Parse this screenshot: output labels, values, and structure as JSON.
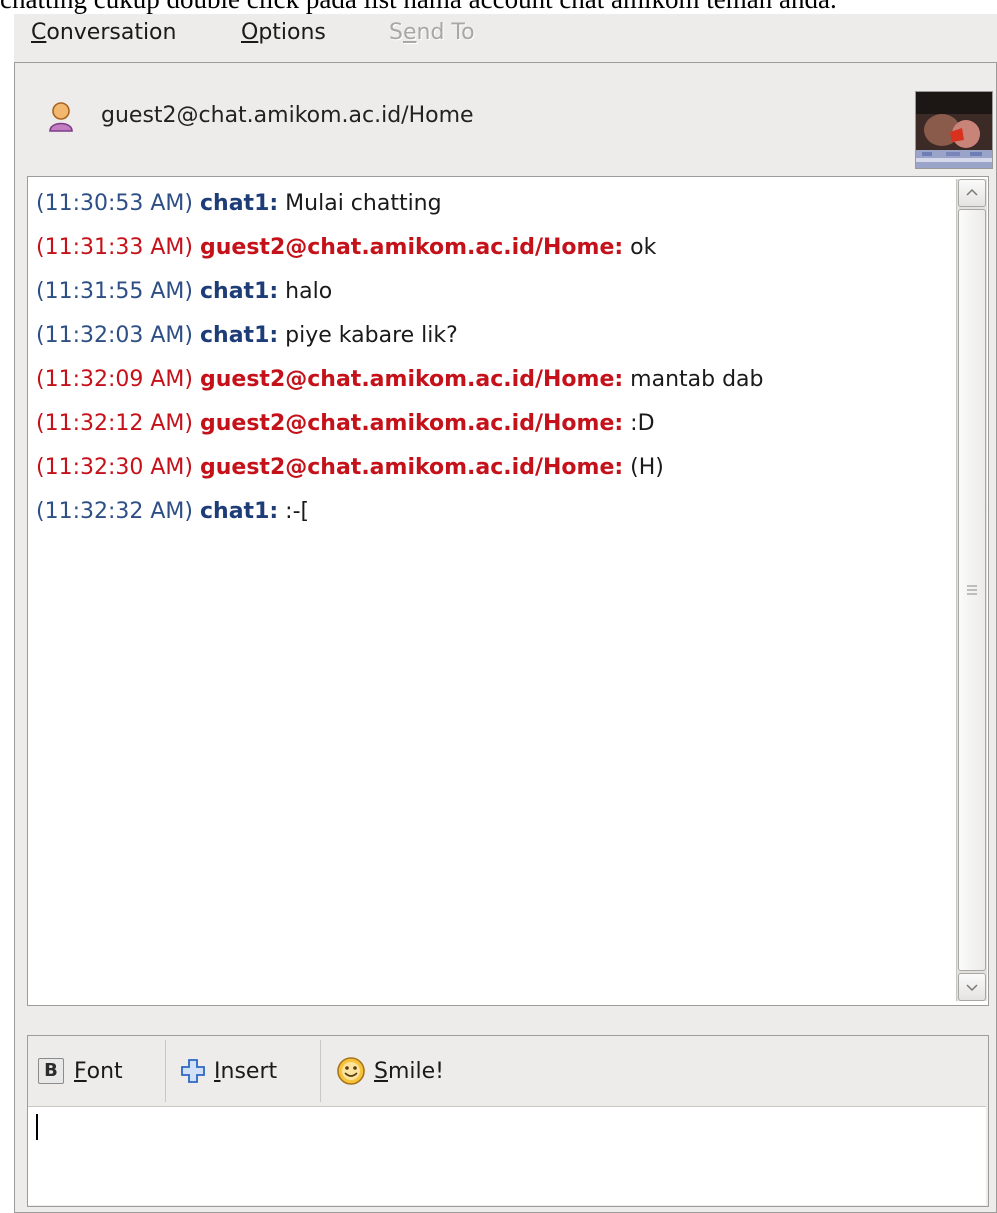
{
  "caption": "chatting cukup double click pada list nama account chat amikom teman anda.",
  "menubar": {
    "conversation": {
      "prefix": "",
      "accel": "C",
      "rest": "onversation"
    },
    "options": {
      "prefix": "",
      "accel": "O",
      "rest": "ptions"
    },
    "send_to": {
      "prefix": "S",
      "accel": "e",
      "rest": "nd To"
    }
  },
  "header": {
    "buddy_name": "guest2@chat.amikom.ac.id/Home",
    "buddy_icon": "person-icon",
    "avatar": "buddy-avatar-photo"
  },
  "messages": [
    {
      "time": "(11:30:53 AM)",
      "sender": "chat1:",
      "text": "Mulai chatting",
      "who": "them"
    },
    {
      "time": "(11:31:33 AM)",
      "sender": "guest2@chat.amikom.ac.id/Home:",
      "text": "ok",
      "who": "me"
    },
    {
      "time": "(11:31:55 AM)",
      "sender": "chat1:",
      "text": "halo",
      "who": "them"
    },
    {
      "time": "(11:32:03 AM)",
      "sender": "chat1:",
      "text": "piye kabare lik?",
      "who": "them"
    },
    {
      "time": "(11:32:09 AM)",
      "sender": "guest2@chat.amikom.ac.id/Home:",
      "text": "mantab dab",
      "who": "me"
    },
    {
      "time": "(11:32:12 AM)",
      "sender": "guest2@chat.amikom.ac.id/Home:",
      "text": ":D",
      "who": "me"
    },
    {
      "time": "(11:32:30 AM)",
      "sender": "guest2@chat.amikom.ac.id/Home:",
      "text": "(H)",
      "who": "me"
    },
    {
      "time": "(11:32:32 AM)",
      "sender": "chat1:",
      "text": ":-[",
      "who": "them"
    }
  ],
  "toolbar": {
    "font": {
      "icon_glyph": "B",
      "accel": "F",
      "rest": "ont"
    },
    "insert": {
      "accel": "I",
      "rest": "nsert"
    },
    "smile": {
      "accel": "S",
      "rest": "mile!"
    }
  },
  "colors": {
    "self": "#c5111a",
    "other_time": "#2e4f86",
    "other_name": "#1d3c78"
  },
  "compose": {
    "value": ""
  }
}
